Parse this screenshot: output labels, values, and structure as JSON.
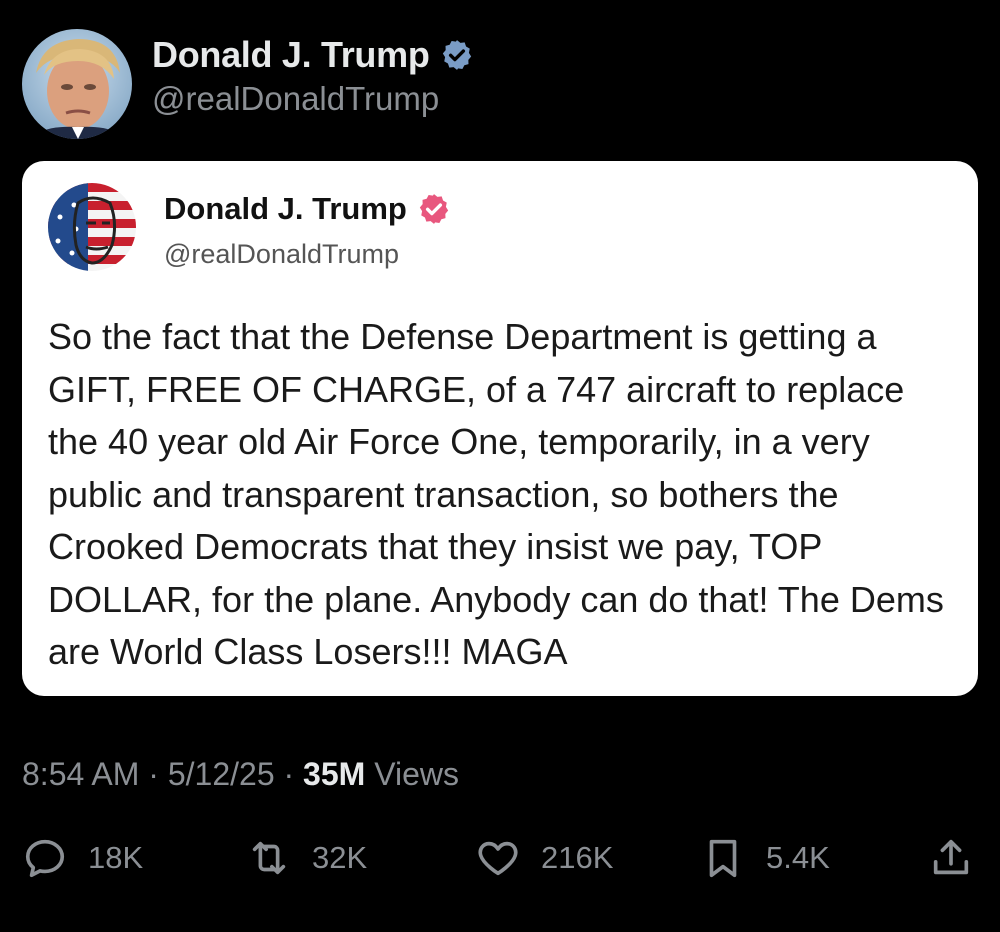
{
  "post": {
    "author_name": "Donald J. Trump",
    "author_handle": "@realDonaldTrump",
    "verified_icon": "blue-verified-badge-icon",
    "avatar_icon": "profile-photo"
  },
  "quoted": {
    "author_name": "Donald J. Trump",
    "author_handle": "@realDonaldTrump",
    "verified_icon": "pink-verified-badge-icon",
    "avatar_icon": "flag-face-avatar",
    "text": "So the fact that the Defense Department is getting a GIFT, FREE OF CHARGE, of a 747 aircraft to replace the 40 year old Air Force One, temporarily, in a very public and transparent transaction, so bothers the Crooked Democrats that they insist we pay, TOP DOLLAR, for the plane. Anybody can do that! The Dems are World Class Losers!!! MAGA"
  },
  "meta": {
    "time": "8:54 AM",
    "date": "5/12/25",
    "separator": "·",
    "views_count": "35M",
    "views_label": "Views"
  },
  "actions": {
    "replies": {
      "icon": "reply-icon",
      "count": "18K"
    },
    "reposts": {
      "icon": "repost-icon",
      "count": "32K"
    },
    "likes": {
      "icon": "heart-icon",
      "count": "216K"
    },
    "bookmarks": {
      "icon": "bookmark-icon",
      "count": "5.4K"
    },
    "share": {
      "icon": "share-icon"
    }
  },
  "colors": {
    "background": "#000000",
    "primary_text": "#e7e9ea",
    "secondary_text": "#8b8f94",
    "verified_blue": "#7a9cc6",
    "verified_pink": "#e8577e"
  }
}
